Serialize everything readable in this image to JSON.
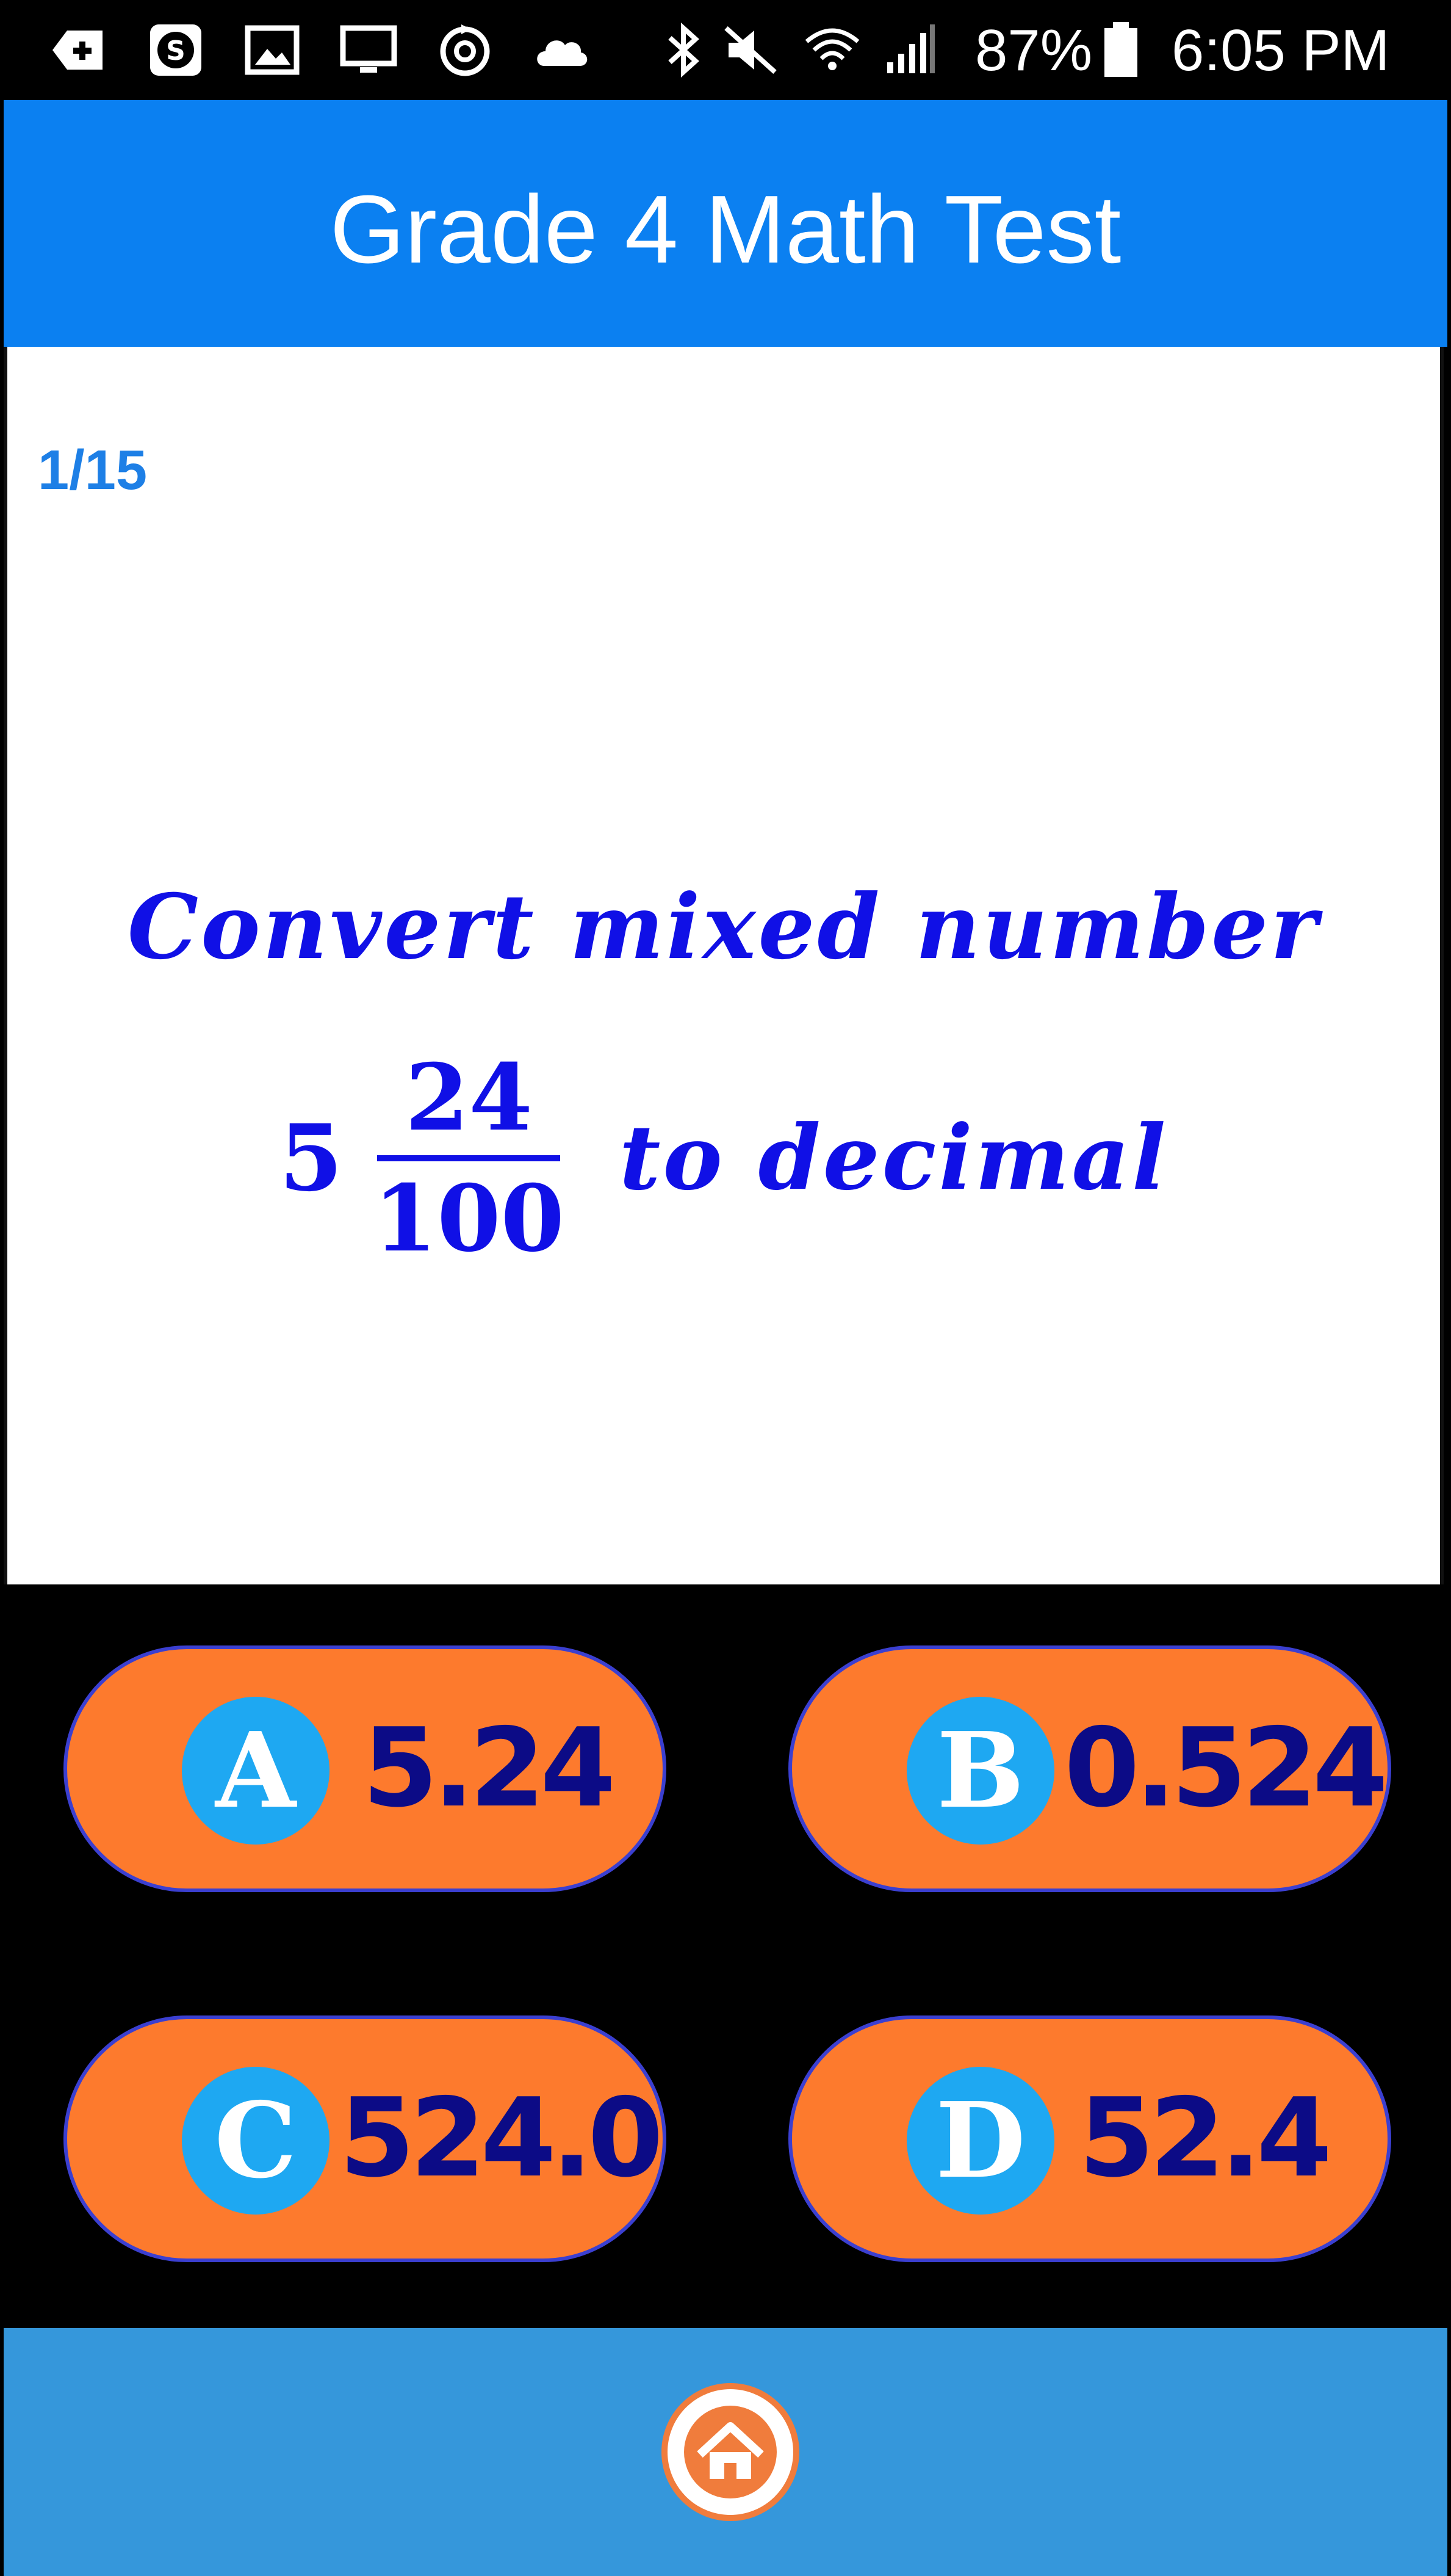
{
  "status_bar": {
    "battery_percent": "87%",
    "time": "6:05 PM",
    "icons": [
      "add-box-icon",
      "s-app-icon",
      "image-icon",
      "screen-cast-icon",
      "sync-icon",
      "cloud-icon",
      "bluetooth-icon",
      "mute-icon",
      "wifi-icon",
      "signal-icon",
      "battery-icon"
    ]
  },
  "header": {
    "title": "Grade 4 Math Test"
  },
  "question": {
    "progress": "1/15",
    "line1": "Convert mixed number",
    "whole": "5",
    "numerator": "24",
    "denominator": "100",
    "tail": "to decimal"
  },
  "answers": [
    {
      "letter": "A",
      "value": "5.24"
    },
    {
      "letter": "B",
      "value": "0.524"
    },
    {
      "letter": "C",
      "value": "524.0"
    },
    {
      "letter": "D",
      "value": "52.4"
    }
  ],
  "bottom_bar": {
    "home_icon": "home-icon"
  },
  "colors": {
    "header_bg": "#0b80f1",
    "question_text": "#1010e6",
    "progress_text": "#1d7fe6",
    "answer_bg": "#fd7a2d",
    "answer_text": "#0c0b86",
    "letter_circle": "#1ea8f2",
    "bottom_bar_bg": "#3597db"
  }
}
